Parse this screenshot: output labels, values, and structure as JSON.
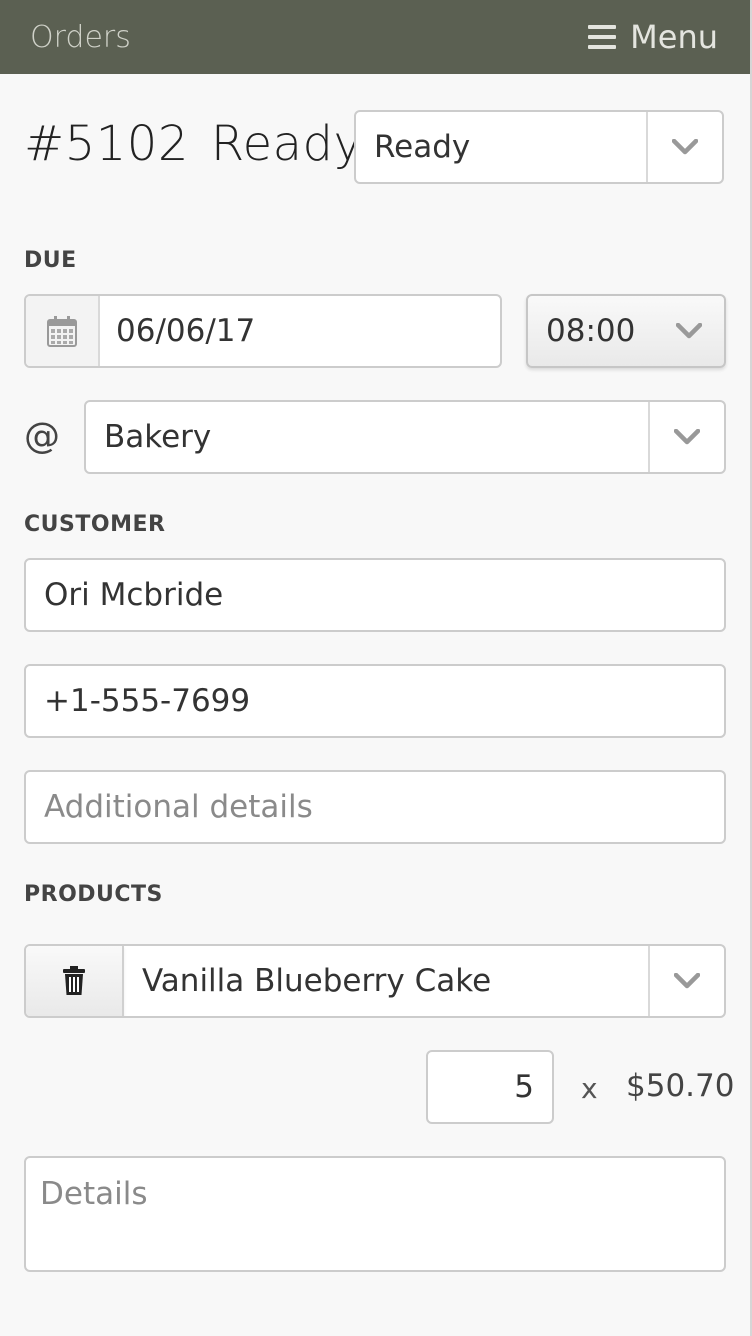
{
  "header": {
    "brand": "Orders",
    "menu_label": "Menu"
  },
  "order": {
    "number": "#5102",
    "status_title": "Ready",
    "status_select": "Ready"
  },
  "due": {
    "label": "DUE",
    "date": "06/06/17",
    "time": "08:00",
    "at_symbol": "@",
    "location": "Bakery"
  },
  "customer": {
    "label": "CUSTOMER",
    "name": "Ori Mcbride",
    "phone": "+1-555-7699",
    "details_placeholder": "Additional details"
  },
  "products": {
    "label": "PRODUCTS",
    "items": [
      {
        "name": "Vanilla Blueberry Cake",
        "quantity": "5",
        "times": "x",
        "price": "$50.70",
        "details_placeholder": "Details"
      }
    ]
  },
  "icons": {
    "menu": "hamburger-icon",
    "calendar": "calendar-icon",
    "trash": "trash-icon",
    "dropdown": "chevron-down-icon"
  },
  "colors": {
    "topbar": "#5b6052",
    "background": "#f8f8f8",
    "border": "#cccccc"
  }
}
